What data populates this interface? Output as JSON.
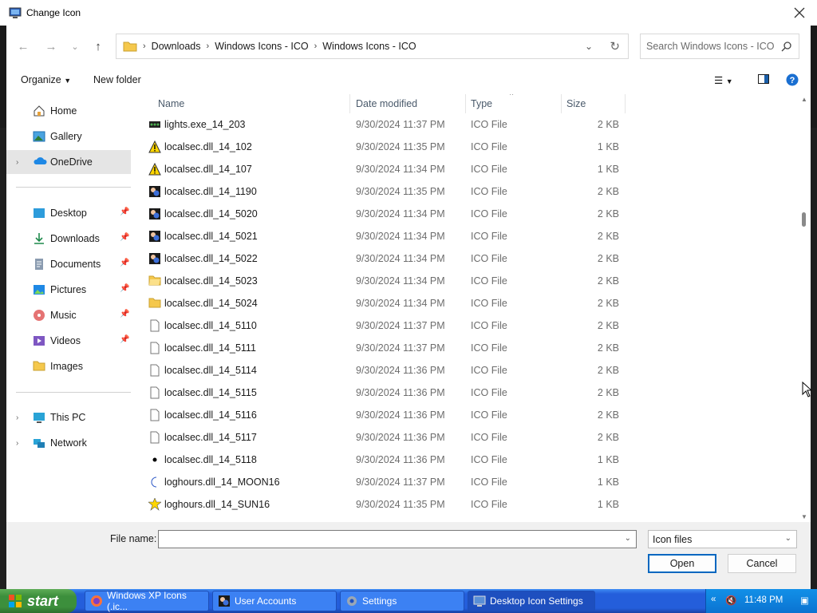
{
  "window": {
    "title": "Change Icon"
  },
  "address": {
    "crumbs": [
      "Downloads",
      "Windows Icons - ICO",
      "Windows Icons - ICO"
    ]
  },
  "search": {
    "placeholder": "Search Windows Icons - ICO"
  },
  "toolbar": {
    "organize": "Organize",
    "new_folder": "New folder"
  },
  "sidebar": {
    "items": [
      {
        "label": "Home",
        "icon": "home-icon"
      },
      {
        "label": "Gallery",
        "icon": "gallery-icon"
      },
      {
        "label": "OneDrive",
        "icon": "onedrive-icon",
        "selected": true
      },
      {
        "label": "Desktop",
        "icon": "desktop-icon",
        "pinned": true
      },
      {
        "label": "Downloads",
        "icon": "downloads-icon",
        "pinned": true
      },
      {
        "label": "Documents",
        "icon": "documents-icon",
        "pinned": true
      },
      {
        "label": "Pictures",
        "icon": "pictures-icon",
        "pinned": true
      },
      {
        "label": "Music",
        "icon": "music-icon",
        "pinned": true
      },
      {
        "label": "Videos",
        "icon": "videos-icon",
        "pinned": true
      },
      {
        "label": "Images",
        "icon": "folder-icon"
      },
      {
        "label": "This PC",
        "icon": "pc-icon"
      },
      {
        "label": "Network",
        "icon": "network-icon"
      }
    ]
  },
  "columns": {
    "name": "Name",
    "date": "Date modified",
    "type": "Type",
    "size": "Size"
  },
  "files": [
    {
      "name": "lights.exe_14_203",
      "date": "9/30/2024 11:37 PM",
      "type": "ICO File",
      "size": "2 KB",
      "icon": "lights-icon"
    },
    {
      "name": "localsec.dll_14_102",
      "date": "9/30/2024 11:35 PM",
      "type": "ICO File",
      "size": "1 KB",
      "icon": "warning-icon"
    },
    {
      "name": "localsec.dll_14_107",
      "date": "9/30/2024 11:34 PM",
      "type": "ICO File",
      "size": "1 KB",
      "icon": "warning-icon"
    },
    {
      "name": "localsec.dll_14_1190",
      "date": "9/30/2024 11:35 PM",
      "type": "ICO File",
      "size": "2 KB",
      "icon": "users-icon"
    },
    {
      "name": "localsec.dll_14_5020",
      "date": "9/30/2024 11:34 PM",
      "type": "ICO File",
      "size": "2 KB",
      "icon": "users-icon"
    },
    {
      "name": "localsec.dll_14_5021",
      "date": "9/30/2024 11:34 PM",
      "type": "ICO File",
      "size": "2 KB",
      "icon": "users-icon"
    },
    {
      "name": "localsec.dll_14_5022",
      "date": "9/30/2024 11:34 PM",
      "type": "ICO File",
      "size": "2 KB",
      "icon": "users-icon"
    },
    {
      "name": "localsec.dll_14_5023",
      "date": "9/30/2024 11:34 PM",
      "type": "ICO File",
      "size": "2 KB",
      "icon": "folder-open-icon"
    },
    {
      "name": "localsec.dll_14_5024",
      "date": "9/30/2024 11:34 PM",
      "type": "ICO File",
      "size": "2 KB",
      "icon": "folder-icon"
    },
    {
      "name": "localsec.dll_14_5110",
      "date": "9/30/2024 11:37 PM",
      "type": "ICO File",
      "size": "2 KB",
      "icon": "blank-file-icon"
    },
    {
      "name": "localsec.dll_14_5111",
      "date": "9/30/2024 11:37 PM",
      "type": "ICO File",
      "size": "2 KB",
      "icon": "blank-file-icon"
    },
    {
      "name": "localsec.dll_14_5114",
      "date": "9/30/2024 11:36 PM",
      "type": "ICO File",
      "size": "2 KB",
      "icon": "blank-file-icon"
    },
    {
      "name": "localsec.dll_14_5115",
      "date": "9/30/2024 11:36 PM",
      "type": "ICO File",
      "size": "2 KB",
      "icon": "blank-file-icon"
    },
    {
      "name": "localsec.dll_14_5116",
      "date": "9/30/2024 11:36 PM",
      "type": "ICO File",
      "size": "2 KB",
      "icon": "blank-file-icon"
    },
    {
      "name": "localsec.dll_14_5117",
      "date": "9/30/2024 11:36 PM",
      "type": "ICO File",
      "size": "2 KB",
      "icon": "blank-file-icon"
    },
    {
      "name": "localsec.dll_14_5118",
      "date": "9/30/2024 11:36 PM",
      "type": "ICO File",
      "size": "1 KB",
      "icon": "dot-icon"
    },
    {
      "name": "loghours.dll_14_MOON16",
      "date": "9/30/2024 11:37 PM",
      "type": "ICO File",
      "size": "1 KB",
      "icon": "moon-icon"
    },
    {
      "name": "loghours.dll_14_SUN16",
      "date": "9/30/2024 11:35 PM",
      "type": "ICO File",
      "size": "1 KB",
      "icon": "sun-icon"
    }
  ],
  "bottom": {
    "file_name_label": "File name:",
    "file_name_value": "",
    "filter": "Icon files",
    "open": "Open",
    "cancel": "Cancel"
  },
  "taskbar": {
    "start": "start",
    "tasks": [
      {
        "label": "Windows XP Icons (.ic...",
        "icon": "firefox-icon"
      },
      {
        "label": "User Accounts",
        "icon": "users-icon"
      },
      {
        "label": "Settings",
        "icon": "gear-icon"
      },
      {
        "label": "Desktop Icon Settings",
        "icon": "monitor-icon",
        "active": true
      }
    ],
    "clock": "11:48 PM"
  }
}
